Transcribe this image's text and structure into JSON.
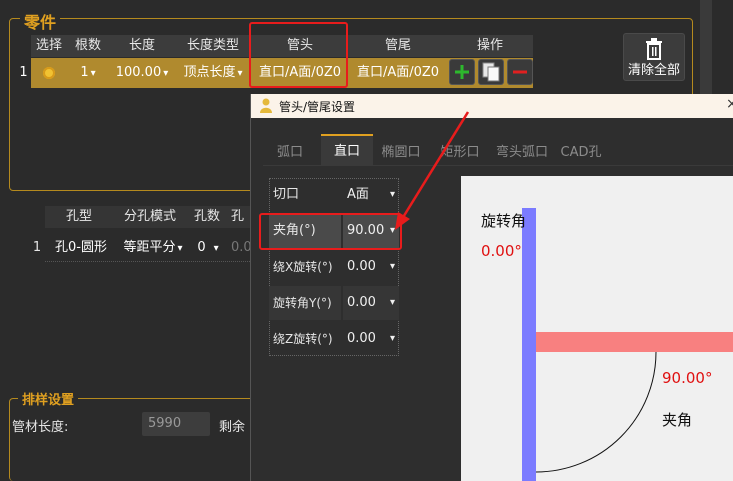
{
  "parts_group": {
    "title": "零件"
  },
  "parts_table": {
    "headers": [
      "选择",
      "根数",
      "长度",
      "长度类型",
      "管头",
      "管尾",
      "操作"
    ],
    "row": {
      "index": "1",
      "count": "1",
      "length": "100.00",
      "length_type": "顶点长度",
      "head": "直口/A面/0Z0",
      "tail": "直口/A面/0Z0"
    }
  },
  "clear_all": {
    "label": "清除全部"
  },
  "holes_table": {
    "headers": [
      "孔型",
      "分孔模式",
      "孔数",
      "孔"
    ],
    "row": {
      "index": "1",
      "type": "孔0-圆形",
      "mode": "等距平分",
      "num": "0",
      "extra": "0.0"
    }
  },
  "layout_group": {
    "title": "排样设置",
    "tube_length_label": "管材长度:",
    "tube_length_value": "5990",
    "remaining_label": "剩余"
  },
  "dialog": {
    "title": "管头/管尾设置",
    "close": "×",
    "tabs": [
      "弧口",
      "直口",
      "椭圆口",
      "矩形口",
      "弯头弧口",
      "CAD孔"
    ],
    "active_tab": "直口",
    "props": [
      {
        "label": "切口",
        "value": "A面"
      },
      {
        "label": "夹角(°)",
        "value": "90.00"
      },
      {
        "label": "绕X旋转(°)",
        "value": "0.00"
      },
      {
        "label": "旋转角Y(°)",
        "value": "0.00"
      },
      {
        "label": "绕Z旋转(°)",
        "value": "0.00"
      }
    ],
    "preview": {
      "rotation_label": "旋转角",
      "rotation_value": "0.00°",
      "angle_value": "90.00°",
      "angle_label": "夹角"
    }
  },
  "colors": {
    "accent": "#e0a020",
    "selected_row": "#b08a2e",
    "highlight": "#e81c1c",
    "preview_blue": "#7b7bff",
    "preview_pink": "#f88080"
  }
}
